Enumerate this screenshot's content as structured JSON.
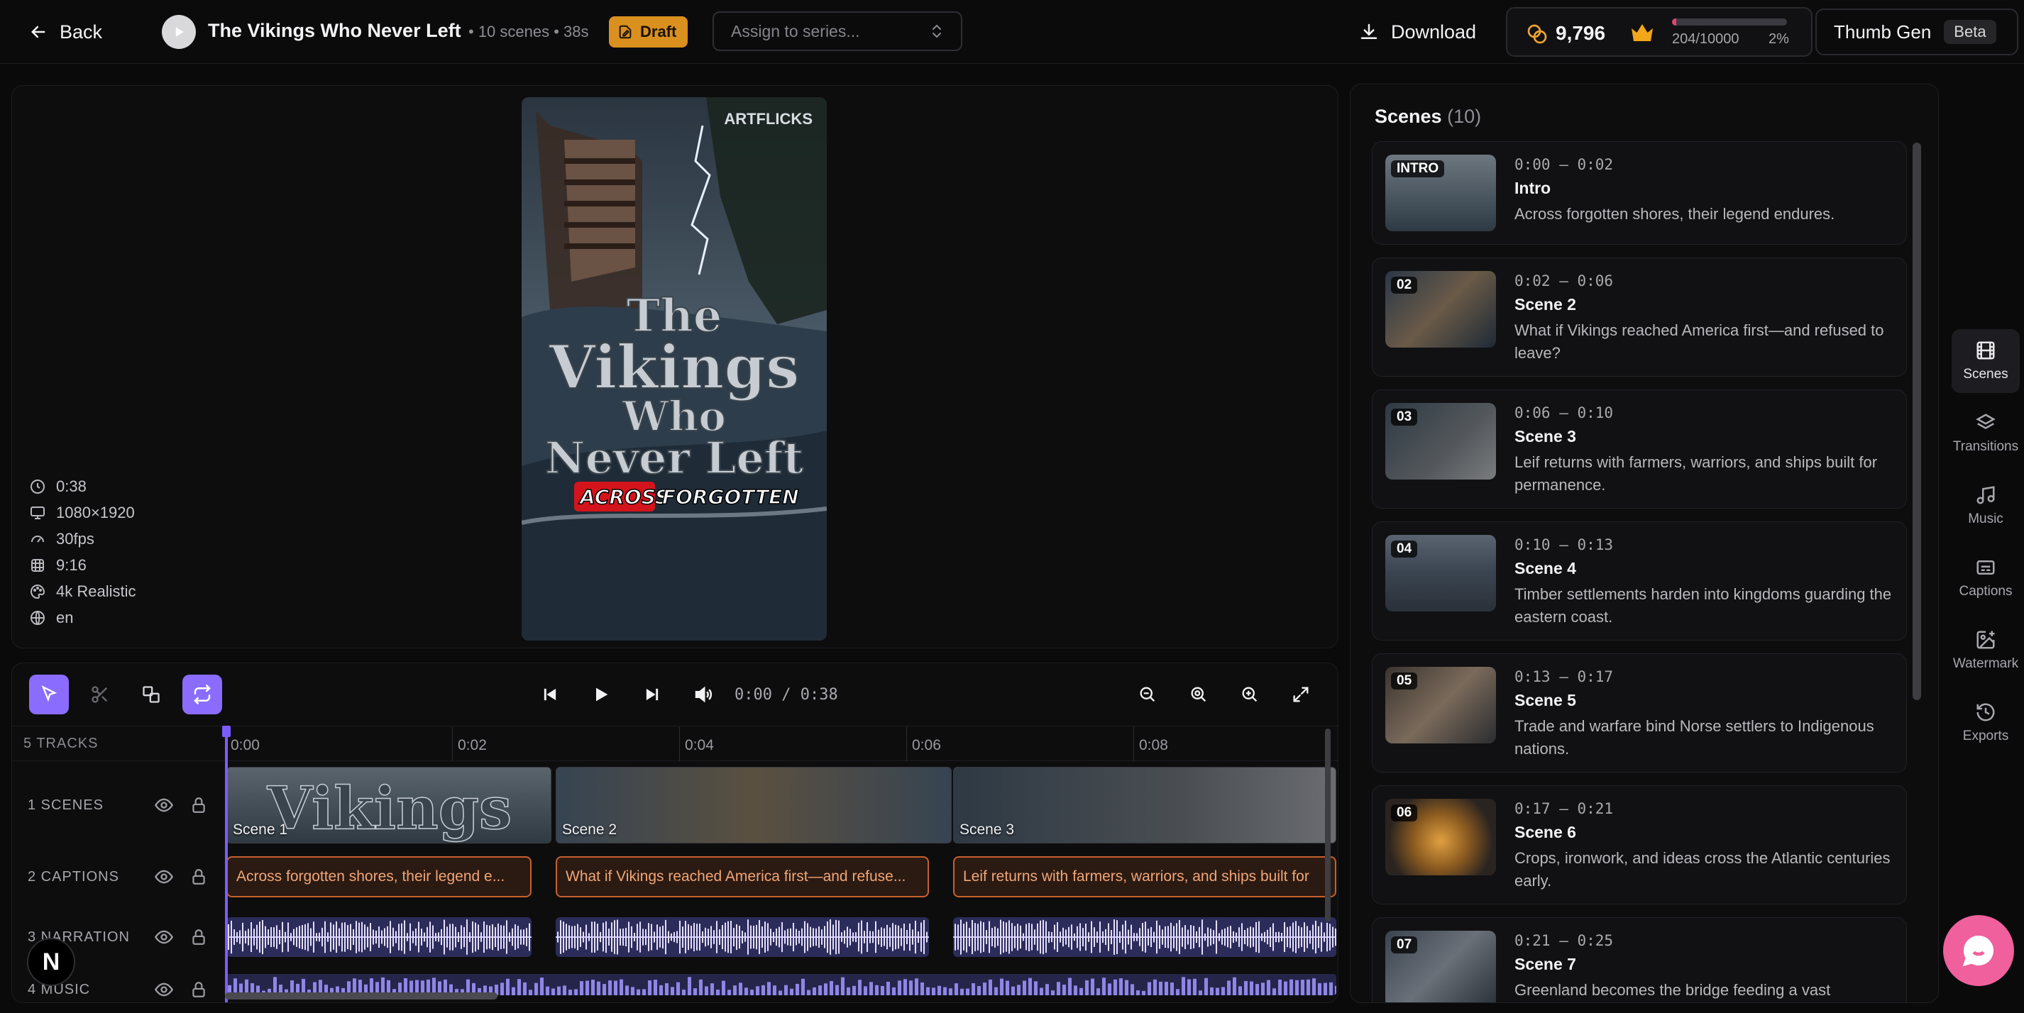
{
  "topbar": {
    "back_label": "Back",
    "project_title": "The Vikings Who Never Left",
    "meta": "• 10 scenes • 38s",
    "status_badge": "Draft",
    "series_placeholder": "Assign to series...",
    "download_label": "Download",
    "credits": "9,796",
    "usage": "204/10000",
    "usage_fraction": 0.0204,
    "usage_pct": "2%",
    "thumb_gen_label": "Thumb Gen",
    "beta_label": "Beta"
  },
  "preview": {
    "poster": {
      "brand": "ARTFLICKS",
      "title_line1": "The",
      "title_line2": "Vikings",
      "title_line3": "Who",
      "title_line4": "Never Left",
      "caption_word_highlight": "ACROSS",
      "caption_word_rest": "FORGOTTEN"
    },
    "meta": [
      {
        "icon": "clock-icon",
        "value": "0:38"
      },
      {
        "icon": "monitor-icon",
        "value": "1080×1920"
      },
      {
        "icon": "gauge-icon",
        "value": "30fps"
      },
      {
        "icon": "frame-icon",
        "value": "9:16"
      },
      {
        "icon": "palette-icon",
        "value": "4k Realistic"
      },
      {
        "icon": "globe-icon",
        "value": "en"
      }
    ]
  },
  "timeline": {
    "time_display": "0:00 / 0:38",
    "tracks_label": "5 TRACKS",
    "ruler": [
      "0:00",
      "0:02",
      "0:04",
      "0:06",
      "0:08"
    ],
    "tracks": [
      {
        "name": "1  SCENES"
      },
      {
        "name": "2  CAPTIONS"
      },
      {
        "name": "3  NARRATION"
      },
      {
        "name": "4  MUSIC"
      }
    ],
    "scene_clips": [
      "Scene 1",
      "Scene 2",
      "Scene 3"
    ],
    "caption_clips": [
      "Across forgotten shores, their legend e...",
      "What if Vikings reached America first—and refuse...",
      "Leif returns with farmers, warriors, and ships built for"
    ]
  },
  "scenes": {
    "title": "Scenes",
    "count": "(10)",
    "items": [
      {
        "badge": "INTRO",
        "time": "0:00 – 0:02",
        "name": "Intro",
        "desc": "Across forgotten shores, their legend endures."
      },
      {
        "badge": "02",
        "time": "0:02 – 0:06",
        "name": "Scene 2",
        "desc": "What if Vikings reached America first—and refused to leave?"
      },
      {
        "badge": "03",
        "time": "0:06 – 0:10",
        "name": "Scene 3",
        "desc": "Leif returns with farmers, warriors, and ships built for permanence."
      },
      {
        "badge": "04",
        "time": "0:10 – 0:13",
        "name": "Scene 4",
        "desc": "Timber settlements harden into kingdoms guarding the eastern coast."
      },
      {
        "badge": "05",
        "time": "0:13 – 0:17",
        "name": "Scene 5",
        "desc": "Trade and warfare bind Norse settlers to Indigenous nations."
      },
      {
        "badge": "06",
        "time": "0:17 – 0:21",
        "name": "Scene 6",
        "desc": "Crops, ironwork, and ideas cross the Atlantic centuries early."
      },
      {
        "badge": "07",
        "time": "0:21 – 0:25",
        "name": "Scene 7",
        "desc": "Greenland becomes the bridge feeding a vast"
      }
    ]
  },
  "rail": [
    {
      "label": "Scenes",
      "icon": "film-icon"
    },
    {
      "label": "Transitions",
      "icon": "layers-icon"
    },
    {
      "label": "Music",
      "icon": "music-icon"
    },
    {
      "label": "Captions",
      "icon": "captions-icon"
    },
    {
      "label": "Watermark",
      "icon": "image-plus-icon"
    },
    {
      "label": "Exports",
      "icon": "history-icon"
    }
  ],
  "colors": {
    "accent": "#8a6dff",
    "draft": "#d9901e",
    "caption_border": "#c4622c",
    "chat": "#f0609c"
  }
}
